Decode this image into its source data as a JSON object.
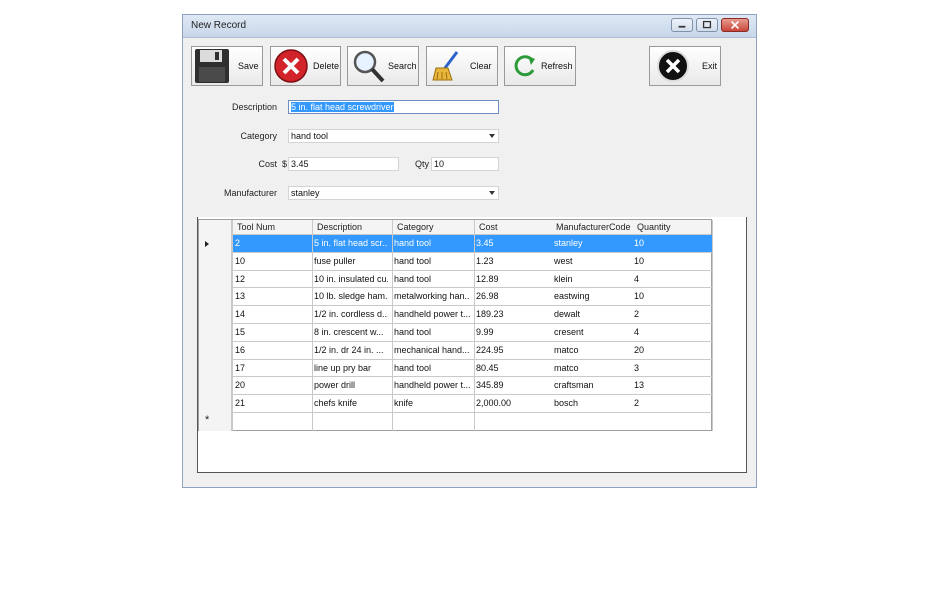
{
  "window": {
    "title": "New Record"
  },
  "toolbar": {
    "save_label": "Save",
    "delete_label": "Delete",
    "search_label": "Search",
    "clear_label": "Clear",
    "refresh_label": "Refresh",
    "exit_label": "Exit"
  },
  "form": {
    "description_label": "Description",
    "description_value": "5 in. flat head screwdriver",
    "category_label": "Category",
    "category_value": "hand tool",
    "cost_label": "Cost",
    "cost_currency": "$",
    "cost_value": "3.45",
    "qty_label": "Qty",
    "qty_value": "10",
    "manufacturer_label": "Manufacturer",
    "manufacturer_value": "stanley"
  },
  "grid": {
    "columns": [
      "Tool Num",
      "Description",
      "Category",
      "Cost",
      "ManufacturerCode",
      "Quantity"
    ],
    "rows": [
      [
        "2",
        "5 in. flat head scr...",
        "hand tool",
        "3.45",
        "stanley",
        "10"
      ],
      [
        "10",
        "fuse puller",
        "hand tool",
        "1.23",
        "west",
        "10"
      ],
      [
        "12",
        "10 in. insulated cu...",
        "hand tool",
        "12.89",
        "klein",
        "4"
      ],
      [
        "13",
        "10 lb. sledge ham...",
        "metalworking han...",
        "26.98",
        "eastwing",
        "10"
      ],
      [
        "14",
        "1/2 in. cordless d...",
        "handheld power t...",
        "189.23",
        "dewalt",
        "2"
      ],
      [
        "15",
        "8 in. crescent w...",
        "hand tool",
        "9.99",
        "cresent",
        "4"
      ],
      [
        "16",
        "1/2 in. dr 24 in. ...",
        "mechanical hand...",
        "224.95",
        "matco",
        "20"
      ],
      [
        "17",
        "line up pry bar",
        "hand tool",
        "80.45",
        "matco",
        "3"
      ],
      [
        "20",
        "power drill",
        "handheld power t...",
        "345.89",
        "craftsman",
        "13"
      ],
      [
        "21",
        "chefs knife",
        "knife",
        "2,000.00",
        "bosch",
        "2"
      ]
    ],
    "new_row_marker": "*"
  }
}
